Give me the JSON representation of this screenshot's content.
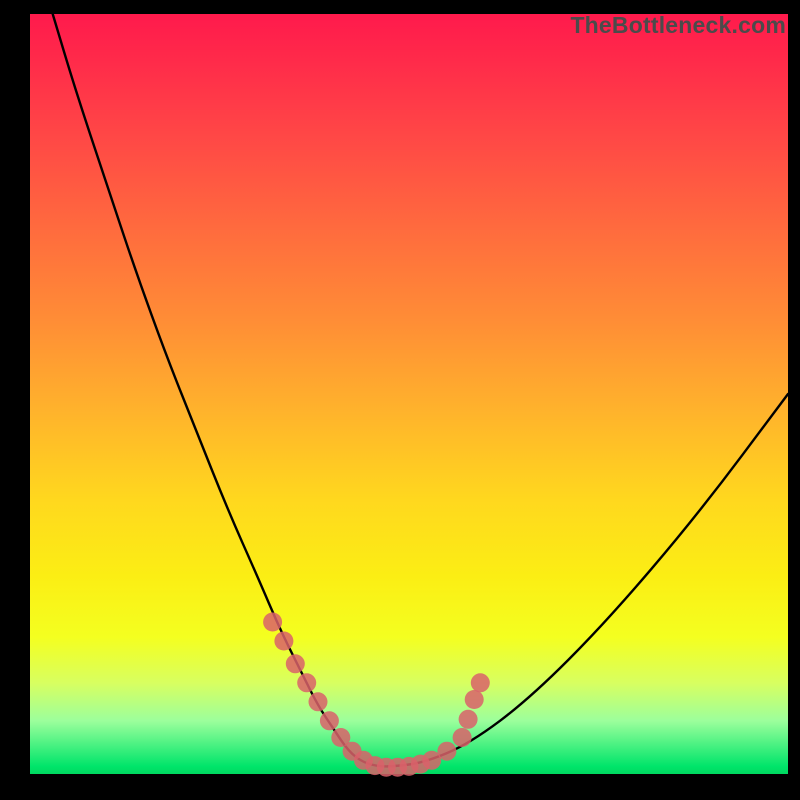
{
  "watermark": {
    "text": "TheBottleneck.com"
  },
  "colors": {
    "curve_stroke": "#000000",
    "marker_stroke": "#d9626a",
    "marker_fill": "#d9626a"
  },
  "chart_data": {
    "type": "line",
    "title": "",
    "xlabel": "",
    "ylabel": "",
    "xlim": [
      0,
      100
    ],
    "ylim": [
      0,
      100
    ],
    "grid": false,
    "legend": false,
    "series": [
      {
        "name": "curve",
        "x": [
          3,
          6,
          10,
          14,
          18,
          22,
          26,
          30,
          33,
          36,
          38,
          40,
          42,
          44,
          46,
          48,
          52,
          58,
          66,
          76,
          88,
          100
        ],
        "y": [
          100,
          90,
          78,
          66,
          55,
          45,
          35,
          26,
          19,
          13,
          9,
          6,
          3,
          1.5,
          1,
          1,
          1.5,
          4,
          10,
          20,
          34,
          50
        ]
      }
    ],
    "markers": [
      {
        "cluster": "left",
        "x": 32.0,
        "y": 20.0
      },
      {
        "cluster": "left",
        "x": 33.5,
        "y": 17.5
      },
      {
        "cluster": "left",
        "x": 35.0,
        "y": 14.5
      },
      {
        "cluster": "left",
        "x": 36.5,
        "y": 12.0
      },
      {
        "cluster": "left",
        "x": 38.0,
        "y": 9.5
      },
      {
        "cluster": "left",
        "x": 39.5,
        "y": 7.0
      },
      {
        "cluster": "left",
        "x": 41.0,
        "y": 4.8
      },
      {
        "cluster": "left",
        "x": 42.5,
        "y": 3.0
      },
      {
        "cluster": "left",
        "x": 44.0,
        "y": 1.8
      },
      {
        "cluster": "floor",
        "x": 45.5,
        "y": 1.1
      },
      {
        "cluster": "floor",
        "x": 47.0,
        "y": 0.9
      },
      {
        "cluster": "floor",
        "x": 48.5,
        "y": 0.9
      },
      {
        "cluster": "floor",
        "x": 50.0,
        "y": 1.0
      },
      {
        "cluster": "floor",
        "x": 51.5,
        "y": 1.3
      },
      {
        "cluster": "floor",
        "x": 53.0,
        "y": 1.8
      },
      {
        "cluster": "right",
        "x": 55.0,
        "y": 3.0
      },
      {
        "cluster": "right",
        "x": 57.0,
        "y": 4.8
      },
      {
        "cluster": "right",
        "x": 57.8,
        "y": 7.2
      },
      {
        "cluster": "right",
        "x": 58.6,
        "y": 9.8
      },
      {
        "cluster": "right",
        "x": 59.4,
        "y": 12.0
      }
    ]
  }
}
